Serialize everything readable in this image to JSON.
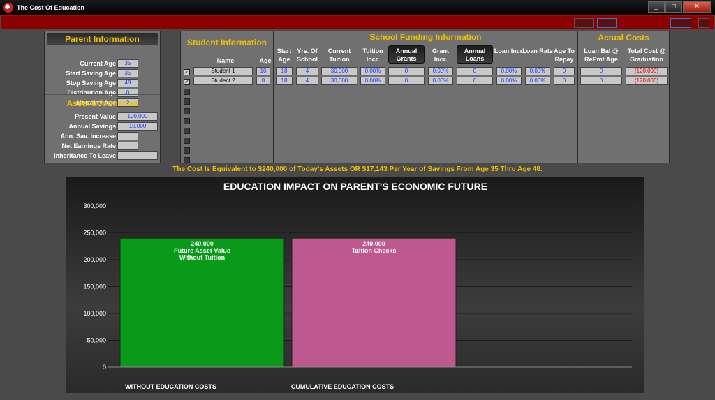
{
  "window": {
    "title": "The Cost Of Education",
    "buttons": [
      "_",
      "□",
      "✕"
    ]
  },
  "parent": {
    "title": "Parent Information",
    "fields": [
      {
        "label": "Current Age",
        "value": "35"
      },
      {
        "label": "Start Saving Age",
        "value": "35"
      },
      {
        "label": "Stop Saving Age",
        "value": "48"
      },
      {
        "label": "Distribution Age",
        "value": "0"
      },
      {
        "label": "Mortality Age",
        "value": "0"
      }
    ]
  },
  "asset": {
    "title": "Asset Information",
    "fields": [
      {
        "label": "Present Value",
        "value": "100,000"
      },
      {
        "label": "Annual Savings",
        "value": "10,000"
      },
      {
        "label": "Ann. Sav. Increase",
        "value": ""
      },
      {
        "label": "Net Earnings Rate",
        "value": ""
      },
      {
        "label": "Inheritance To Leave",
        "value": ""
      }
    ]
  },
  "student": {
    "title": "Student Information",
    "col_name": "Name",
    "col_age": "Age",
    "rows": [
      {
        "name": "Student 1",
        "age": "10",
        "checked": true
      },
      {
        "name": "Student 2",
        "age": "8",
        "checked": true
      }
    ]
  },
  "funding": {
    "title": "School Funding Information",
    "cols": [
      "Start Age",
      "Yrs. Of School",
      "Current Tuition",
      "Tuition Incr.",
      "Annual Grants",
      "Grant Incr.",
      "Annual Loans",
      "Loan Incr.",
      "Loan Rate",
      "Age To Repay"
    ],
    "rows": [
      [
        "18",
        "4",
        "30,000",
        "0.00%",
        "0",
        "0.00%",
        "0",
        "0.00%",
        "0.00%",
        "0"
      ],
      [
        "18",
        "4",
        "30,000",
        "0.00%",
        "0",
        "0.00%",
        "0",
        "0.00%",
        "0.00%",
        "0"
      ]
    ]
  },
  "actual": {
    "title": "Actual Costs",
    "cols": [
      "Loan Bal @ RePmt Age",
      "Total Cost @ Graduation"
    ],
    "rows": [
      [
        "0",
        "(120,000)"
      ],
      [
        "0",
        "(120,000)"
      ]
    ]
  },
  "summary": "The Cost Is Equivalent to $240,000 of Today's Assets OR $17,143 Per Year of Savings From Age 35 Thru Age 48.",
  "chart_data": {
    "type": "bar",
    "title": "EDUCATION IMPACT ON PARENT'S ECONOMIC FUTURE",
    "categories": [
      "WITHOUT EDUCATION COSTS",
      "CUMULATIVE EDUCATION COSTS"
    ],
    "values": [
      240000,
      240000
    ],
    "bar_labels": [
      [
        "240,000",
        "Future Asset Value",
        "Without Tuition"
      ],
      [
        "240,000",
        "Tuition Checks"
      ]
    ],
    "bar_colors": [
      "#0a9a1a",
      "#c05890"
    ],
    "yticks": [
      "0",
      "50,000",
      "100,000",
      "150,000",
      "200,000",
      "250,000",
      "300,000"
    ],
    "ylim": [
      0,
      300000
    ],
    "grid": true
  }
}
